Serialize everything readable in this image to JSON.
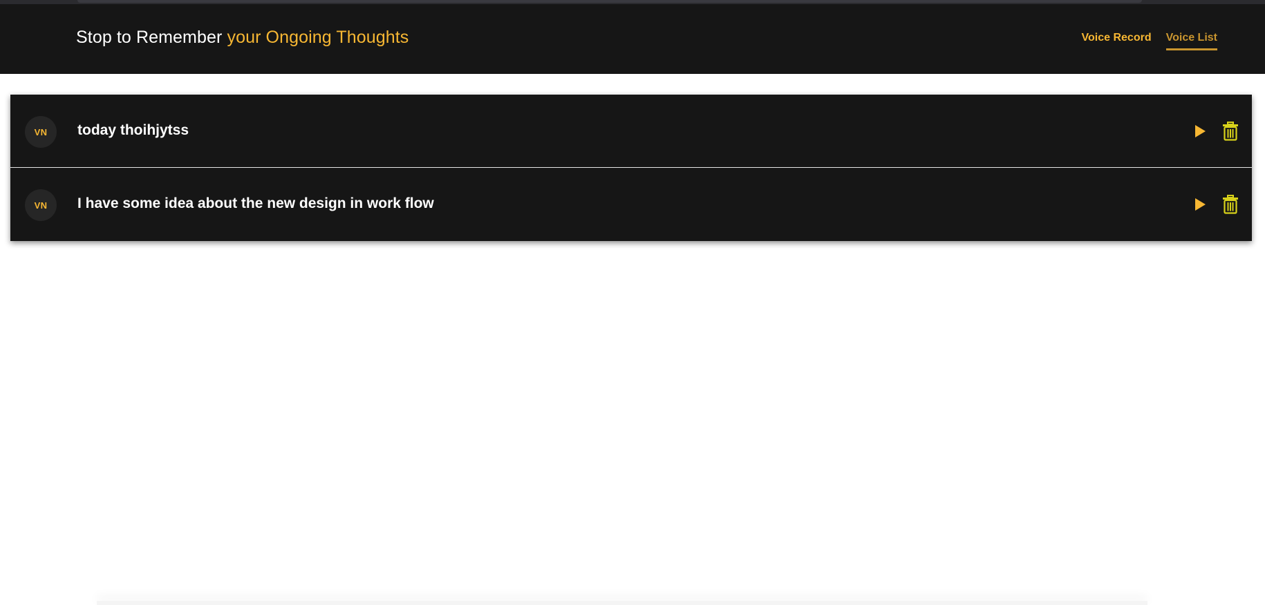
{
  "header": {
    "title_main": "Stop to Remember",
    "title_accent": "your Ongoing Thoughts",
    "nav": [
      {
        "label": "Voice Record",
        "active": false
      },
      {
        "label": "Voice List",
        "active": true
      }
    ]
  },
  "notes": [
    {
      "avatar": "VN",
      "title": "today thoihjytss",
      "play_icon": "play-icon",
      "delete_icon": "trash-icon"
    },
    {
      "avatar": "VN",
      "title": "I have some idea about the new design in work flow",
      "play_icon": "play-icon",
      "delete_icon": "trash-icon"
    }
  ],
  "colors": {
    "accent": "#f7b733",
    "accent_muted": "#c9952f",
    "header_bg": "#161616",
    "row_bg": "#161616",
    "trash": "#d8d21a"
  }
}
